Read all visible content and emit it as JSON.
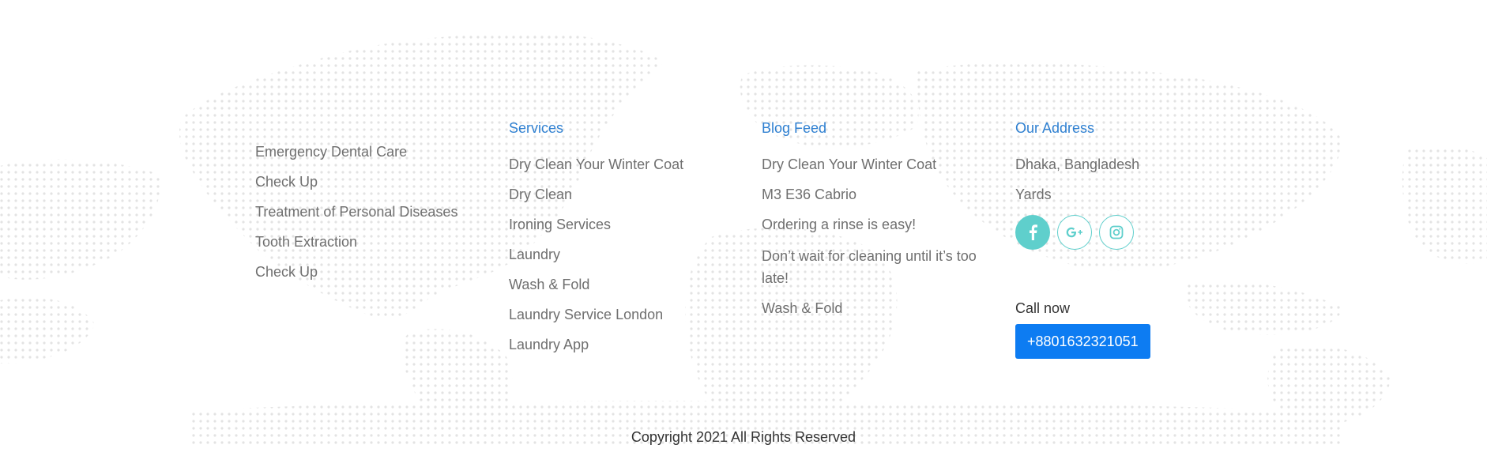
{
  "footer": {
    "col1": {
      "links": [
        "Emergency Dental Care",
        "Check Up",
        "Treatment of Personal Diseases",
        "Tooth Extraction",
        "Check Up"
      ]
    },
    "services": {
      "title": "Services",
      "links": [
        "Dry Clean Your Winter Coat",
        "Dry Clean",
        "Ironing Services",
        "Laundry",
        "Wash & Fold",
        "Laundry Service London",
        "Laundry App"
      ]
    },
    "blog": {
      "title": "Blog Feed",
      "links": [
        "Dry Clean Your Winter Coat",
        "M3 E36 Cabrio",
        "Ordering a rinse is easy!",
        "Don’t wait for cleaning until it’s too late!",
        "Wash & Fold"
      ]
    },
    "address": {
      "title": "Our Address",
      "line1": "Dhaka, Bangladesh",
      "line2": "Yards",
      "social": [
        {
          "icon": "facebook-icon",
          "glyph": "f"
        },
        {
          "icon": "google-plus-icon",
          "glyph": "G+"
        },
        {
          "icon": "instagram-icon",
          "glyph": ""
        }
      ],
      "call_label": "Call now",
      "phone": "+8801632321051"
    },
    "copyright": "Copyright 2021 All Rights Reserved"
  },
  "colors": {
    "heading": "#2f80d1",
    "link": "#6f6f6f",
    "social": "#5fcfcc",
    "button": "#0d7cf2"
  }
}
